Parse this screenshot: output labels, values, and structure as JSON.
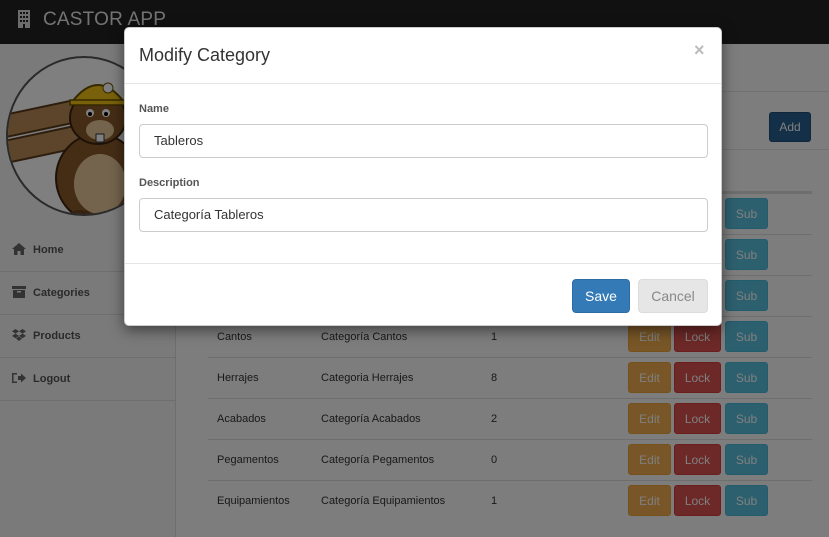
{
  "app": {
    "title": "CASTOR APP",
    "icon": "building-icon"
  },
  "sidebar": {
    "items": [
      {
        "label": "Home",
        "icon": "home-icon"
      },
      {
        "label": "Categories",
        "icon": "box-icon"
      },
      {
        "label": "Products",
        "icon": "dropbox-icon"
      },
      {
        "label": "Logout",
        "icon": "logout-icon"
      }
    ]
  },
  "main": {
    "add_label": "Add",
    "rows": [
      {
        "name": "Cantos",
        "description": "Categoría Cantos",
        "count": "1"
      },
      {
        "name": "Herrajes",
        "description": "Categoria Herrajes",
        "count": "8"
      },
      {
        "name": "Acabados",
        "description": "Categoría Acabados",
        "count": "2"
      },
      {
        "name": "Pegamentos",
        "description": "Categoría Pegamentos",
        "count": "0"
      },
      {
        "name": "Equipamientos",
        "description": "Categoría Equipamientos",
        "count": "1"
      }
    ],
    "row_buttons": {
      "edit": "Edit",
      "lock": "Lock",
      "sub": "Sub"
    }
  },
  "modal": {
    "title": "Modify Category",
    "close": "×",
    "name_label": "Name",
    "name_value": "Tableros",
    "description_label": "Description",
    "description_value": "Categoría Tableros",
    "save_label": "Save",
    "cancel_label": "Cancel"
  },
  "colors": {
    "navbar": "#222222",
    "primary": "#337ab7",
    "warning": "#f0ad4e",
    "danger": "#d9534f",
    "info": "#5bc0de"
  }
}
